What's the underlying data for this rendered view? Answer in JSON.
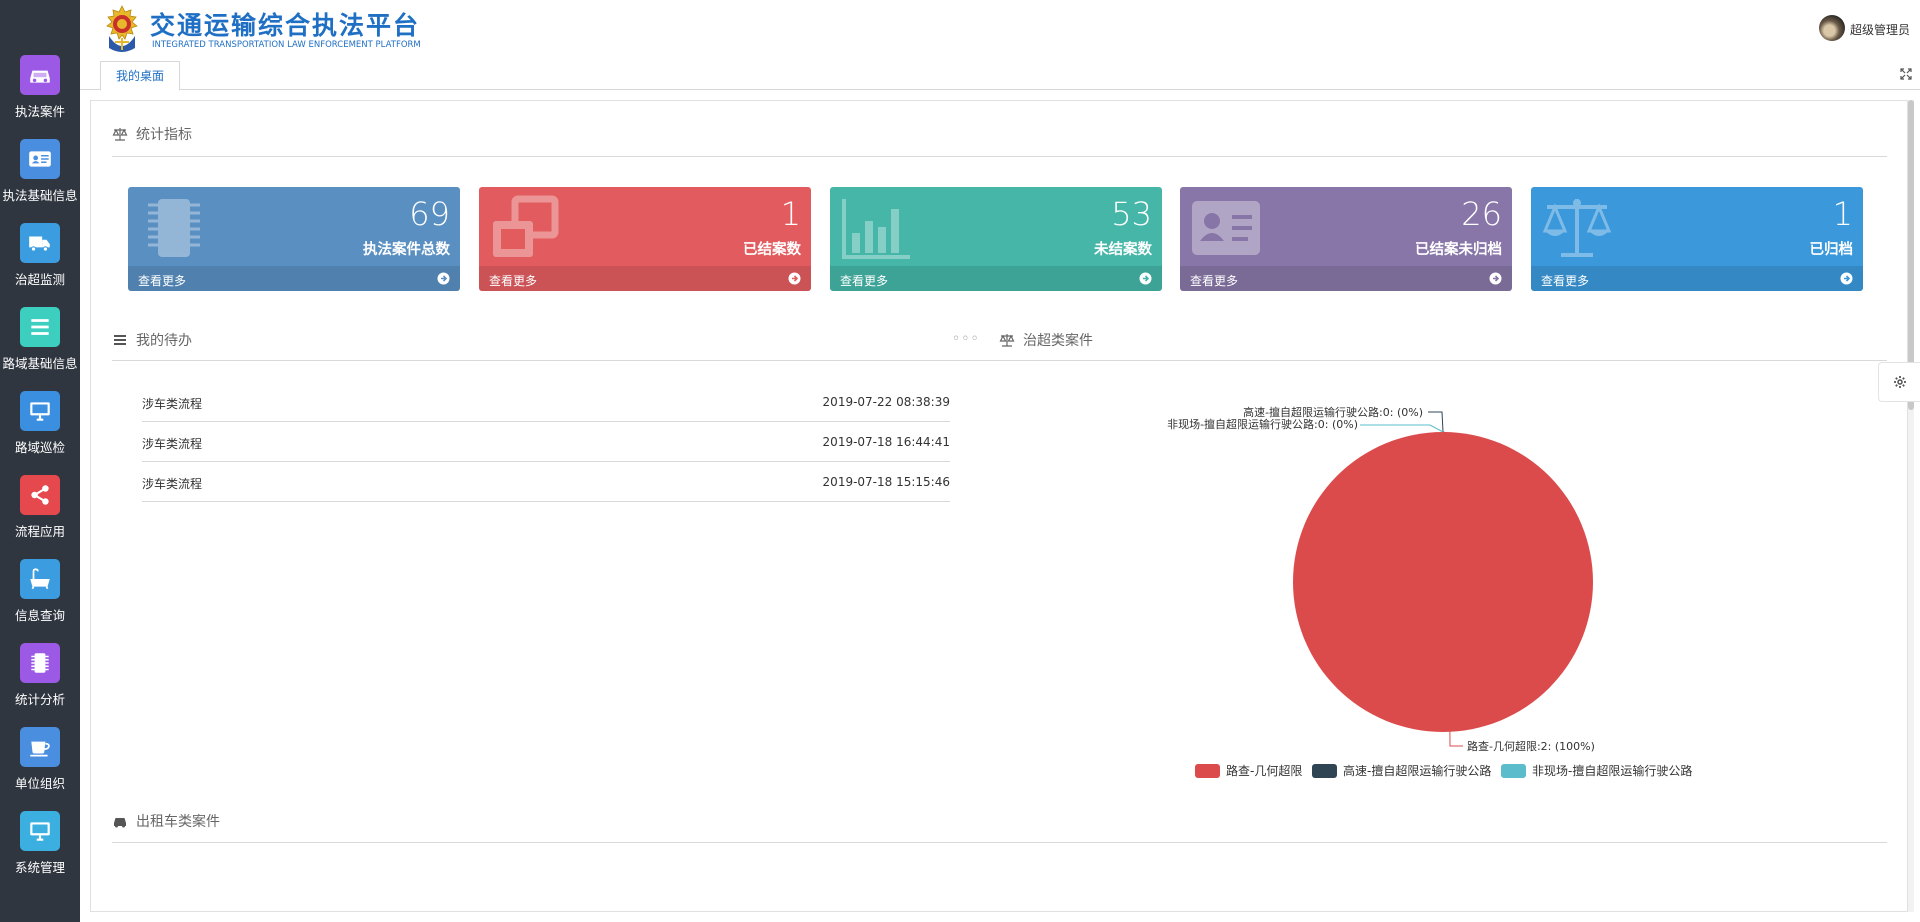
{
  "sidebar": {
    "items": [
      {
        "label": "执法案件",
        "icon": "car-icon",
        "color": "#9b59e6"
      },
      {
        "label": "执法基础信息",
        "icon": "id-card-icon",
        "color": "#4a8ee0"
      },
      {
        "label": "治超监测",
        "icon": "truck-icon",
        "color": "#3b9de0"
      },
      {
        "label": "路域基础信息",
        "icon": "list-icon",
        "color": "#3ccfc0"
      },
      {
        "label": "路域巡检",
        "icon": "monitor-icon",
        "color": "#3b8fe0"
      },
      {
        "label": "流程应用",
        "icon": "share-icon",
        "color": "#e5484d"
      },
      {
        "label": "信息查询",
        "icon": "bathtub-icon",
        "color": "#3b9de0"
      },
      {
        "label": "统计分析",
        "icon": "chip-icon",
        "color": "#9b59e6"
      },
      {
        "label": "单位组织",
        "icon": "coffee-icon",
        "color": "#4a8ee0"
      },
      {
        "label": "系统管理",
        "icon": "monitor-icon",
        "color": "#3bb0e0"
      }
    ]
  },
  "header": {
    "title": "交通运输综合执法平台",
    "subtitle": "INTEGRATED TRANSPORTATION LAW ENFORCEMENT PLATFORM",
    "user_name": "超级管理员"
  },
  "tabs": {
    "home_label": "我的桌面"
  },
  "sections": {
    "stats_title": "统计指标",
    "todo_title": "我的待办",
    "overload_title": "治超类案件",
    "taxi_title": "出租车类案件"
  },
  "cards": [
    {
      "value": "69",
      "label": "执法案件总数",
      "more": "查看更多",
      "color": "#5a8fc2",
      "icon": "chip-icon"
    },
    {
      "value": "1",
      "label": "已结案数",
      "more": "查看更多",
      "color": "#e25c5f",
      "icon": "clone-icon"
    },
    {
      "value": "53",
      "label": "未结案数",
      "more": "查看更多",
      "color": "#45b6a8",
      "icon": "bar-chart-icon"
    },
    {
      "value": "26",
      "label": "已结案未归档",
      "more": "查看更多",
      "color": "#8876a8",
      "icon": "id-card-icon"
    },
    {
      "value": "1",
      "label": "已归档",
      "more": "查看更多",
      "color": "#3a98db",
      "icon": "balance-scale-icon"
    }
  ],
  "todos": [
    {
      "name": "涉车类流程",
      "time": "2019-07-22 08:38:39"
    },
    {
      "name": "涉车类流程",
      "time": "2019-07-18 16:44:41"
    },
    {
      "name": "涉车类流程",
      "time": "2019-07-18 15:15:46"
    }
  ],
  "chart_data": {
    "type": "pie",
    "series": [
      {
        "name": "路查-几何超限",
        "value": 2,
        "percent": "100%",
        "color": "#dc4b4b",
        "label": "路查-几何超限:2: (100%)"
      },
      {
        "name": "高速-擅自超限运输行驶公路",
        "value": 0,
        "percent": "0%",
        "color": "#2f4554",
        "label": "高速-擅自超限运输行驶公路:0: (0%)"
      },
      {
        "name": "非现场-擅自超限运输行驶公路",
        "value": 0,
        "percent": "0%",
        "color": "#5bbccb",
        "label": "非现场-擅自超限运输行驶公路:0: (0%)"
      }
    ],
    "legend_position": "bottom"
  }
}
